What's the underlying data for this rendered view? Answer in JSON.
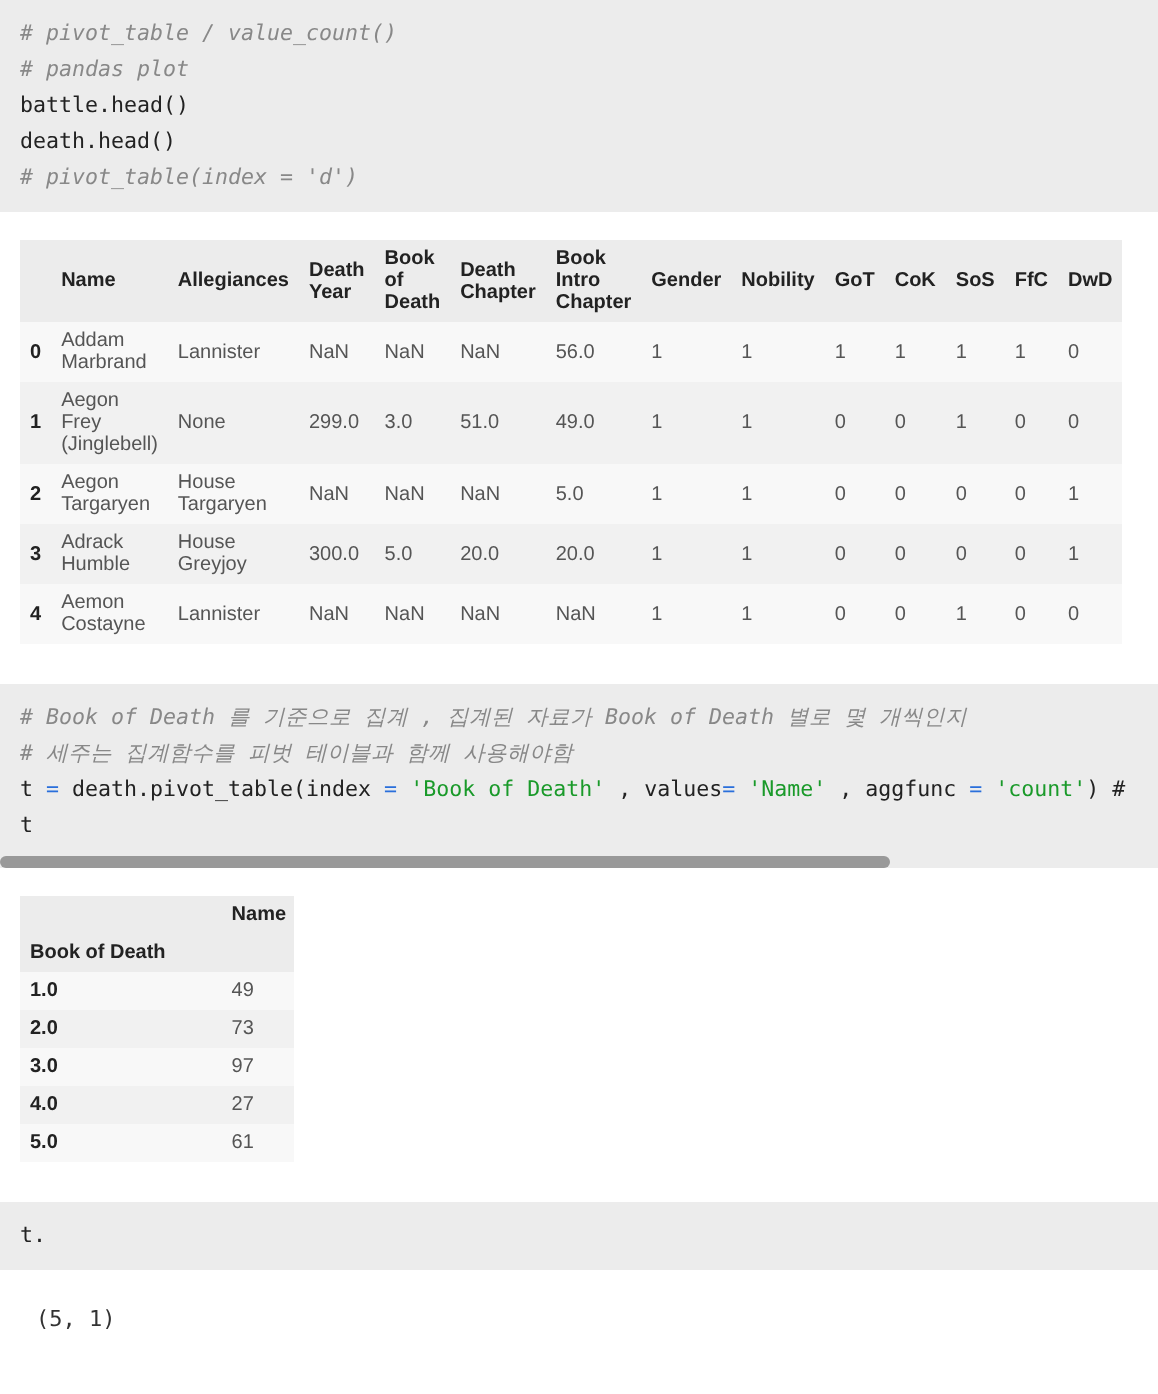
{
  "cells": [
    {
      "kind": "code",
      "lines": [
        [
          {
            "kind": "comment",
            "text": "# pivot_table / value_count()"
          }
        ],
        [
          {
            "kind": "comment",
            "text": "# pandas plot"
          }
        ],
        [
          {
            "kind": "plain",
            "text": "battle.head()"
          }
        ],
        [
          {
            "kind": "plain",
            "text": "death.head()"
          }
        ],
        [
          {
            "kind": "comment",
            "text": "# pivot_table(index = 'd')"
          }
        ]
      ]
    },
    {
      "kind": "table",
      "columns": [
        "Name",
        "Allegiances",
        "Death Year",
        "Book of Death",
        "Death Chapter",
        "Book Intro Chapter",
        "Gender",
        "Nobility",
        "GoT",
        "CoK",
        "SoS",
        "FfC",
        "DwD"
      ],
      "rows": [
        {
          "index": "0",
          "cells": [
            "Addam Marbrand",
            "Lannister",
            "NaN",
            "NaN",
            "NaN",
            "56.0",
            "1",
            "1",
            "1",
            "1",
            "1",
            "1",
            "0"
          ]
        },
        {
          "index": "1",
          "cells": [
            "Aegon Frey (Jinglebell)",
            "None",
            "299.0",
            "3.0",
            "51.0",
            "49.0",
            "1",
            "1",
            "0",
            "0",
            "1",
            "0",
            "0"
          ]
        },
        {
          "index": "2",
          "cells": [
            "Aegon Targaryen",
            "House Targaryen",
            "NaN",
            "NaN",
            "NaN",
            "5.0",
            "1",
            "1",
            "0",
            "0",
            "0",
            "0",
            "1"
          ]
        },
        {
          "index": "3",
          "cells": [
            "Adrack Humble",
            "House Greyjoy",
            "300.0",
            "5.0",
            "20.0",
            "20.0",
            "1",
            "1",
            "0",
            "0",
            "0",
            "0",
            "1"
          ]
        },
        {
          "index": "4",
          "cells": [
            "Aemon Costayne",
            "Lannister",
            "NaN",
            "NaN",
            "NaN",
            "NaN",
            "1",
            "1",
            "0",
            "0",
            "1",
            "0",
            "0"
          ]
        }
      ]
    },
    {
      "kind": "code",
      "scrollbar": true,
      "lines": [
        [
          {
            "kind": "comment",
            "text": "# Book of Death 를 기준으로 집계 , 집계된 자료가 Book of Death 별로 몇 개씩인지"
          }
        ],
        [
          {
            "kind": "comment",
            "text": "# 세주는 집계함수를 피벗 테이블과 함께 사용해야함"
          }
        ],
        [
          {
            "kind": "plain",
            "text": "t"
          },
          {
            "kind": "op",
            "text": " = "
          },
          {
            "kind": "plain",
            "text": "death.pivot_table(index "
          },
          {
            "kind": "op",
            "text": "= "
          },
          {
            "kind": "string",
            "text": "'Book of Death'"
          },
          {
            "kind": "plain",
            "text": " , values"
          },
          {
            "kind": "op",
            "text": "= "
          },
          {
            "kind": "string",
            "text": "'Name'"
          },
          {
            "kind": "plain",
            "text": " , aggfunc "
          },
          {
            "kind": "op",
            "text": "= "
          },
          {
            "kind": "string",
            "text": "'count'"
          },
          {
            "kind": "plain",
            "text": ") #"
          }
        ],
        [
          {
            "kind": "plain",
            "text": "t"
          }
        ]
      ]
    },
    {
      "kind": "table",
      "index_name": "Book of Death",
      "columns": [
        "Name"
      ],
      "rows": [
        {
          "index": "1.0",
          "cells": [
            "49"
          ]
        },
        {
          "index": "2.0",
          "cells": [
            "73"
          ]
        },
        {
          "index": "3.0",
          "cells": [
            "97"
          ]
        },
        {
          "index": "4.0",
          "cells": [
            "27"
          ]
        },
        {
          "index": "5.0",
          "cells": [
            "61"
          ]
        }
      ]
    },
    {
      "kind": "code",
      "lines": [
        [
          {
            "kind": "plain",
            "text": "t."
          }
        ]
      ]
    },
    {
      "kind": "output",
      "text": "(5, 1)"
    }
  ]
}
